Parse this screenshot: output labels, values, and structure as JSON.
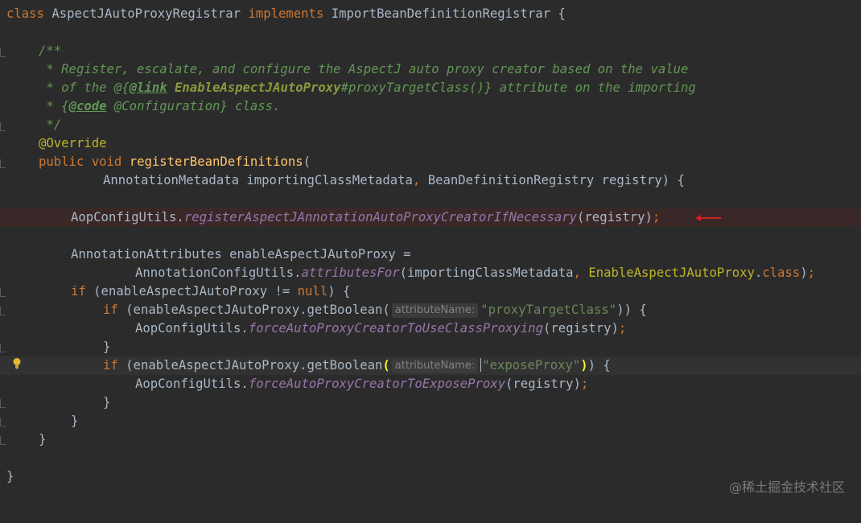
{
  "lines": [
    {
      "id": "l1"
    },
    {
      "id": "l2"
    }
  ],
  "code": {
    "kw_class": "class",
    "class_name": "AspectJAutoProxyRegistrar",
    "kw_implements": "implements",
    "iface": "ImportBeanDefinitionRegistrar",
    "open_brace": " {",
    "doc_open": "/**",
    "doc1": " * Register, escalate, and configure the AspectJ auto proxy creator based on the value",
    "doc2_a": " * of the @{",
    "doc2_link": "@link",
    "doc2_ref": "EnableAspectJAutoProxy",
    "doc2_b": "#proxyTargetClass()} attribute on the importing",
    "doc3_a": " * {",
    "doc3_code": "@code",
    "doc3_b": " @Configuration} class.",
    "doc_close": " */",
    "override": "@Override",
    "kw_public": "public",
    "kw_void": "void",
    "method": "registerBeanDefinitions",
    "paren_open": "(",
    "param_line": "AnnotationMetadata importingClassMetadata",
    "comma": ",",
    "param2": " BeanDefinitionRegistry registry) {",
    "aop": "AopConfigUtils.",
    "register_call": "registerAspectJAnnotationAutoProxyCreatorIfNecessary",
    "register_arg": "(registry)",
    "semi": ";",
    "attrs_decl": "AnnotationAttributes enableAspectJAutoProxy =",
    "ann_cfg": "AnnotationConfigUtils.",
    "attrs_for": "attributesFor",
    "attrs_args": "(importingClassMetadata",
    "enable_cls": "EnableAspectJAutoProxy",
    "dot_class": ".",
    "kw_class2": "class",
    "close_paren": ")",
    "kw_if": "if",
    "if1_cond": " (enableAspectJAutoProxy != ",
    "kw_null": "null",
    "if1_end": ") {",
    "get_bool": " (enableAspectJAutoProxy.getBoolean(",
    "hint": "attributeName:",
    "str_ptc": "\"proxyTargetClass\"",
    "if2_end": ")) {",
    "force_class": "forceAutoProxyCreatorToUseClassProxying",
    "reg_arg": "(registry)",
    "close_brace": "}",
    "get_bool2": " (enableAspectJAutoProxy.getBoolean",
    "paren_l": "(",
    "str_ep": "\"exposeProxy\"",
    "paren_r": ")",
    "if3_end": ") {",
    "force_expose": "forceAutoProxyCreatorToExposeProxy"
  },
  "watermark": "@稀土掘金技术社区",
  "colors": {
    "background": "#2b2b2b",
    "keyword": "#cc7832",
    "method": "#ffc66d",
    "string": "#6a8759",
    "annotation": "#bbb529",
    "javadoc": "#629755",
    "static_italic": "#9876aa",
    "error_arrow": "#cc2222"
  }
}
